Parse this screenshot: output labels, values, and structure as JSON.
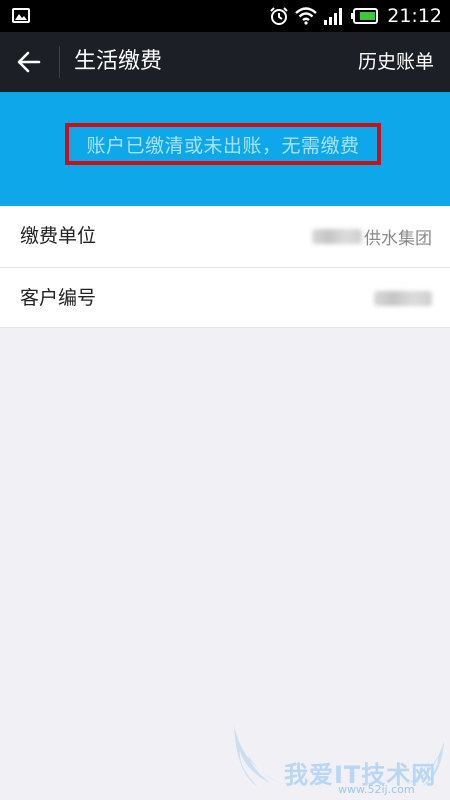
{
  "status_bar": {
    "time": "21:12",
    "icons": [
      "gallery-icon",
      "alarm-icon",
      "wifi-icon",
      "signal-icon",
      "battery-icon"
    ]
  },
  "app_bar": {
    "title": "生活缴费",
    "action": "历史账单",
    "back_icon": "arrow-left-icon"
  },
  "banner": {
    "message": "账户已缴清或未出账，无需缴费",
    "background": "#0ea8ea",
    "highlight_border": "#c8101a"
  },
  "details": [
    {
      "label": "缴费单位",
      "value": "供水集团"
    },
    {
      "label": "客户编号",
      "value": ""
    }
  ],
  "watermark": {
    "text": "我爱IT技术网",
    "url": "www.52ij.com"
  }
}
